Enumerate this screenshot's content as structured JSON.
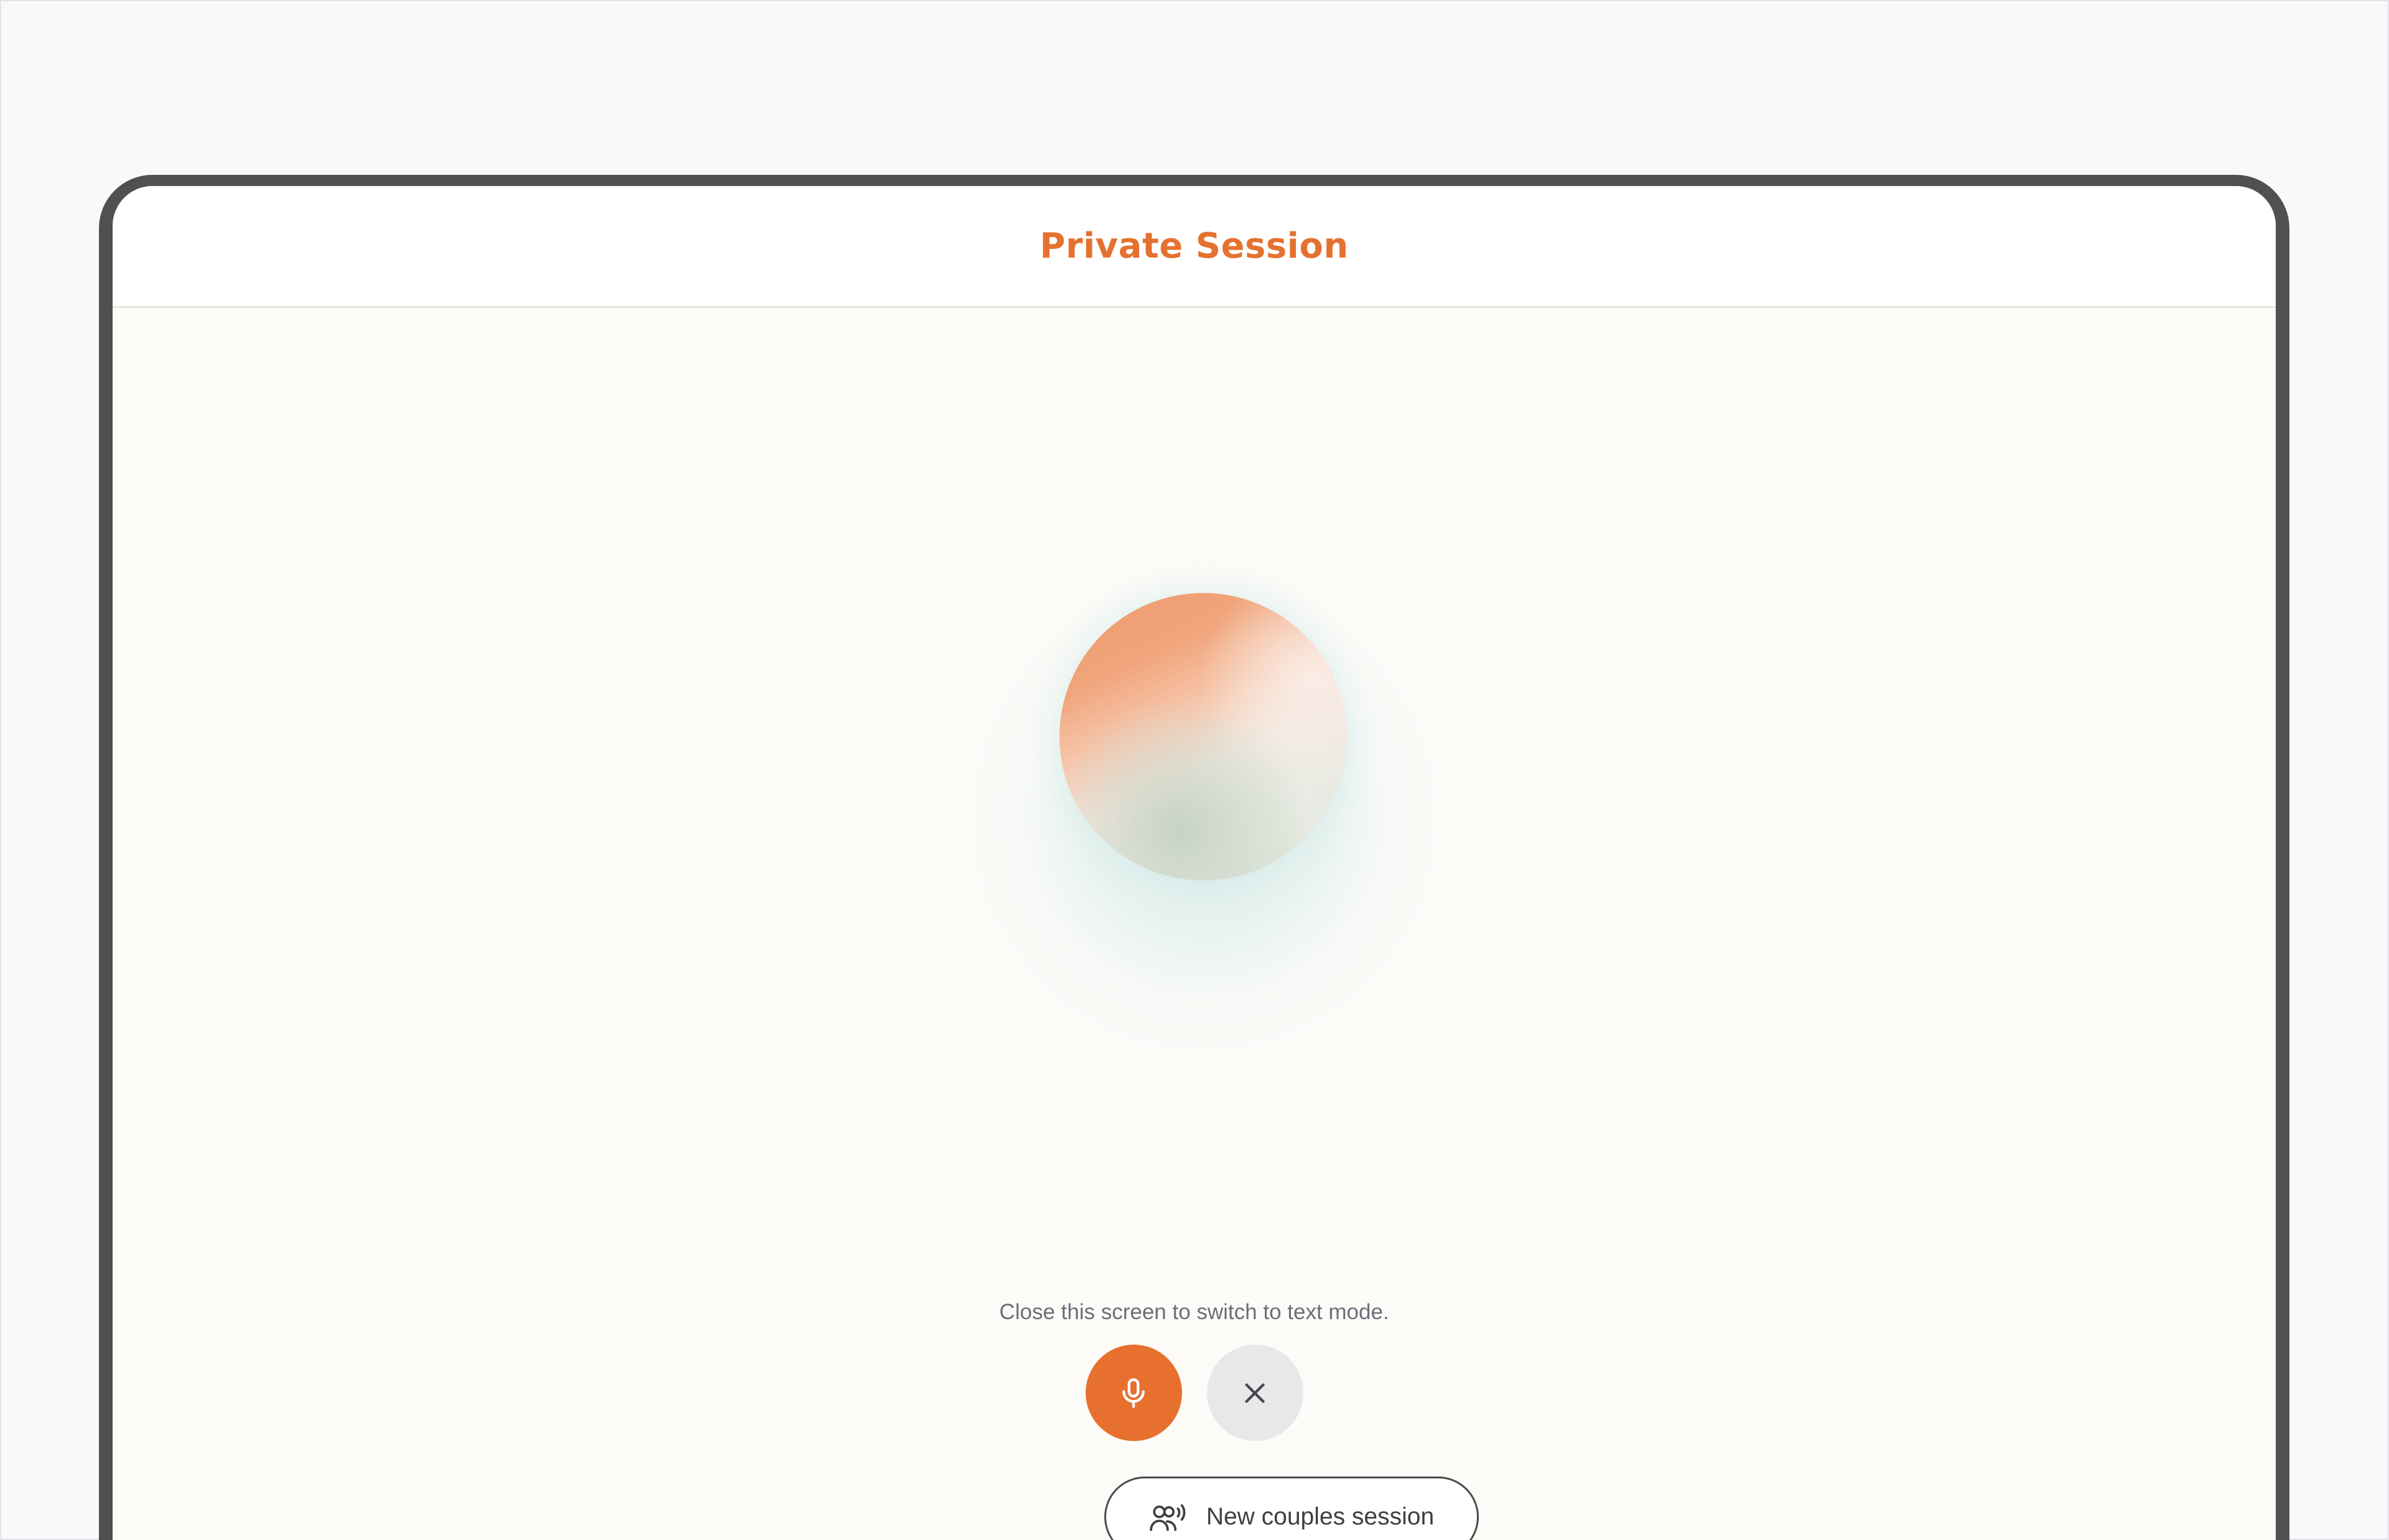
{
  "header": {
    "title": "Private Session"
  },
  "session": {
    "hint": "Close this screen to switch to text mode.",
    "couples_button_label": "New couples session"
  },
  "icons": {
    "mic": "microphone-icon",
    "close": "close-icon",
    "couples": "couples-voice-icon"
  },
  "colors": {
    "accent": "#e8702f",
    "title": "#e5712f",
    "close_button_bg": "#e7e8ea",
    "screen_bg": "#fcfbf8",
    "device_bezel": "#4f5050"
  }
}
